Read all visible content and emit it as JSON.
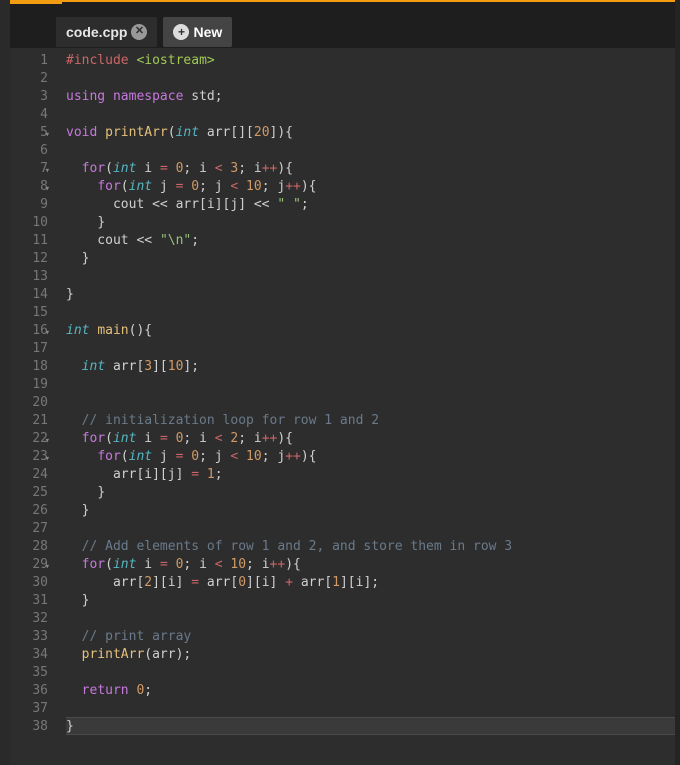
{
  "tabs": {
    "active": {
      "label": "code.cpp"
    },
    "new": {
      "label": "New"
    }
  },
  "gutter": {
    "fold_lines": [
      5,
      7,
      8,
      16,
      22,
      23,
      29
    ]
  },
  "code": [
    {
      "n": 1,
      "tokens": [
        [
          "pp",
          "#include "
        ],
        [
          "inc",
          "<iostream>"
        ]
      ]
    },
    {
      "n": 2,
      "tokens": []
    },
    {
      "n": 3,
      "tokens": [
        [
          "kw",
          "using"
        ],
        [
          "id",
          " "
        ],
        [
          "kw",
          "namespace"
        ],
        [
          "id",
          " std"
        ],
        [
          "pun",
          ";"
        ]
      ]
    },
    {
      "n": 4,
      "tokens": []
    },
    {
      "n": 5,
      "tokens": [
        [
          "kw",
          "void"
        ],
        [
          "id",
          " "
        ],
        [
          "fn",
          "printArr"
        ],
        [
          "pun",
          "("
        ],
        [
          "type",
          "int"
        ],
        [
          "id",
          " arr"
        ],
        [
          "pun",
          "[]["
        ],
        [
          "num",
          "20"
        ],
        [
          "pun",
          "]){"
        ]
      ]
    },
    {
      "n": 6,
      "tokens": []
    },
    {
      "n": 7,
      "tokens": [
        [
          "id",
          "  "
        ],
        [
          "kw",
          "for"
        ],
        [
          "pun",
          "("
        ],
        [
          "type",
          "int"
        ],
        [
          "id",
          " i "
        ],
        [
          "op",
          "="
        ],
        [
          "id",
          " "
        ],
        [
          "num",
          "0"
        ],
        [
          "pun",
          "; "
        ],
        [
          "id",
          "i "
        ],
        [
          "op",
          "<"
        ],
        [
          "id",
          " "
        ],
        [
          "num",
          "3"
        ],
        [
          "pun",
          "; "
        ],
        [
          "id",
          "i"
        ],
        [
          "op",
          "++"
        ],
        [
          "pun",
          "){"
        ]
      ]
    },
    {
      "n": 8,
      "tokens": [
        [
          "id",
          "    "
        ],
        [
          "kw",
          "for"
        ],
        [
          "pun",
          "("
        ],
        [
          "type",
          "int"
        ],
        [
          "id",
          " j "
        ],
        [
          "op",
          "="
        ],
        [
          "id",
          " "
        ],
        [
          "num",
          "0"
        ],
        [
          "pun",
          "; "
        ],
        [
          "id",
          "j "
        ],
        [
          "op",
          "<"
        ],
        [
          "id",
          " "
        ],
        [
          "num",
          "10"
        ],
        [
          "pun",
          "; "
        ],
        [
          "id",
          "j"
        ],
        [
          "op",
          "++"
        ],
        [
          "pun",
          "){"
        ]
      ]
    },
    {
      "n": 9,
      "tokens": [
        [
          "id",
          "      cout "
        ],
        [
          "out",
          "<<"
        ],
        [
          "id",
          " arr[i][j] "
        ],
        [
          "out",
          "<<"
        ],
        [
          "id",
          " "
        ],
        [
          "str",
          "\" \""
        ],
        [
          "pun",
          ";"
        ]
      ]
    },
    {
      "n": 10,
      "tokens": [
        [
          "id",
          "    "
        ],
        [
          "pun",
          "}"
        ]
      ]
    },
    {
      "n": 11,
      "tokens": [
        [
          "id",
          "    cout "
        ],
        [
          "out",
          "<<"
        ],
        [
          "id",
          " "
        ],
        [
          "str",
          "\"\\n\""
        ],
        [
          "pun",
          ";"
        ]
      ]
    },
    {
      "n": 12,
      "tokens": [
        [
          "id",
          "  "
        ],
        [
          "pun",
          "}"
        ]
      ]
    },
    {
      "n": 13,
      "tokens": []
    },
    {
      "n": 14,
      "tokens": [
        [
          "pun",
          "}"
        ]
      ]
    },
    {
      "n": 15,
      "tokens": []
    },
    {
      "n": 16,
      "tokens": [
        [
          "type",
          "int"
        ],
        [
          "id",
          " "
        ],
        [
          "fn",
          "main"
        ],
        [
          "pun",
          "(){"
        ]
      ]
    },
    {
      "n": 17,
      "tokens": []
    },
    {
      "n": 18,
      "tokens": [
        [
          "id",
          "  "
        ],
        [
          "type",
          "int"
        ],
        [
          "id",
          " arr["
        ],
        [
          "num",
          "3"
        ],
        [
          "id",
          "]["
        ],
        [
          "num",
          "10"
        ],
        [
          "id",
          "]"
        ],
        [
          "pun",
          ";"
        ]
      ]
    },
    {
      "n": 19,
      "tokens": []
    },
    {
      "n": 20,
      "tokens": []
    },
    {
      "n": 21,
      "tokens": [
        [
          "id",
          "  "
        ],
        [
          "cmt",
          "// initialization loop for row 1 and 2"
        ]
      ]
    },
    {
      "n": 22,
      "tokens": [
        [
          "id",
          "  "
        ],
        [
          "kw",
          "for"
        ],
        [
          "pun",
          "("
        ],
        [
          "type",
          "int"
        ],
        [
          "id",
          " i "
        ],
        [
          "op",
          "="
        ],
        [
          "id",
          " "
        ],
        [
          "num",
          "0"
        ],
        [
          "pun",
          "; "
        ],
        [
          "id",
          "i "
        ],
        [
          "op",
          "<"
        ],
        [
          "id",
          " "
        ],
        [
          "num",
          "2"
        ],
        [
          "pun",
          "; "
        ],
        [
          "id",
          "i"
        ],
        [
          "op",
          "++"
        ],
        [
          "pun",
          "){"
        ]
      ]
    },
    {
      "n": 23,
      "tokens": [
        [
          "id",
          "    "
        ],
        [
          "kw",
          "for"
        ],
        [
          "pun",
          "("
        ],
        [
          "type",
          "int"
        ],
        [
          "id",
          " j "
        ],
        [
          "op",
          "="
        ],
        [
          "id",
          " "
        ],
        [
          "num",
          "0"
        ],
        [
          "pun",
          "; "
        ],
        [
          "id",
          "j "
        ],
        [
          "op",
          "<"
        ],
        [
          "id",
          " "
        ],
        [
          "num",
          "10"
        ],
        [
          "pun",
          "; "
        ],
        [
          "id",
          "j"
        ],
        [
          "op",
          "++"
        ],
        [
          "pun",
          "){"
        ]
      ]
    },
    {
      "n": 24,
      "tokens": [
        [
          "id",
          "      arr[i][j] "
        ],
        [
          "op",
          "="
        ],
        [
          "id",
          " "
        ],
        [
          "num",
          "1"
        ],
        [
          "pun",
          ";"
        ]
      ]
    },
    {
      "n": 25,
      "tokens": [
        [
          "id",
          "    "
        ],
        [
          "pun",
          "}"
        ]
      ]
    },
    {
      "n": 26,
      "tokens": [
        [
          "id",
          "  "
        ],
        [
          "pun",
          "}"
        ]
      ]
    },
    {
      "n": 27,
      "tokens": []
    },
    {
      "n": 28,
      "tokens": [
        [
          "id",
          "  "
        ],
        [
          "cmt",
          "// Add elements of row 1 and 2, and store them in row 3"
        ]
      ]
    },
    {
      "n": 29,
      "tokens": [
        [
          "id",
          "  "
        ],
        [
          "kw",
          "for"
        ],
        [
          "pun",
          "("
        ],
        [
          "type",
          "int"
        ],
        [
          "id",
          " i "
        ],
        [
          "op",
          "="
        ],
        [
          "id",
          " "
        ],
        [
          "num",
          "0"
        ],
        [
          "pun",
          "; "
        ],
        [
          "id",
          "i "
        ],
        [
          "op",
          "<"
        ],
        [
          "id",
          " "
        ],
        [
          "num",
          "10"
        ],
        [
          "pun",
          "; "
        ],
        [
          "id",
          "i"
        ],
        [
          "op",
          "++"
        ],
        [
          "pun",
          "){"
        ]
      ]
    },
    {
      "n": 30,
      "tokens": [
        [
          "id",
          "      arr["
        ],
        [
          "num",
          "2"
        ],
        [
          "id",
          "][i] "
        ],
        [
          "op",
          "="
        ],
        [
          "id",
          " arr["
        ],
        [
          "num",
          "0"
        ],
        [
          "id",
          "][i] "
        ],
        [
          "op",
          "+"
        ],
        [
          "id",
          " arr["
        ],
        [
          "num",
          "1"
        ],
        [
          "id",
          "][i]"
        ],
        [
          "pun",
          ";"
        ]
      ]
    },
    {
      "n": 31,
      "tokens": [
        [
          "id",
          "  "
        ],
        [
          "pun",
          "}"
        ]
      ]
    },
    {
      "n": 32,
      "tokens": []
    },
    {
      "n": 33,
      "tokens": [
        [
          "id",
          "  "
        ],
        [
          "cmt",
          "// print array"
        ]
      ]
    },
    {
      "n": 34,
      "tokens": [
        [
          "id",
          "  "
        ],
        [
          "fn",
          "printArr"
        ],
        [
          "pun",
          "(arr);"
        ]
      ]
    },
    {
      "n": 35,
      "tokens": []
    },
    {
      "n": 36,
      "tokens": [
        [
          "id",
          "  "
        ],
        [
          "kw",
          "return"
        ],
        [
          "id",
          " "
        ],
        [
          "num",
          "0"
        ],
        [
          "pun",
          ";"
        ]
      ]
    },
    {
      "n": 37,
      "tokens": []
    },
    {
      "n": 38,
      "tokens": [
        [
          "pun",
          "}"
        ]
      ]
    }
  ],
  "cursor_line": 38
}
